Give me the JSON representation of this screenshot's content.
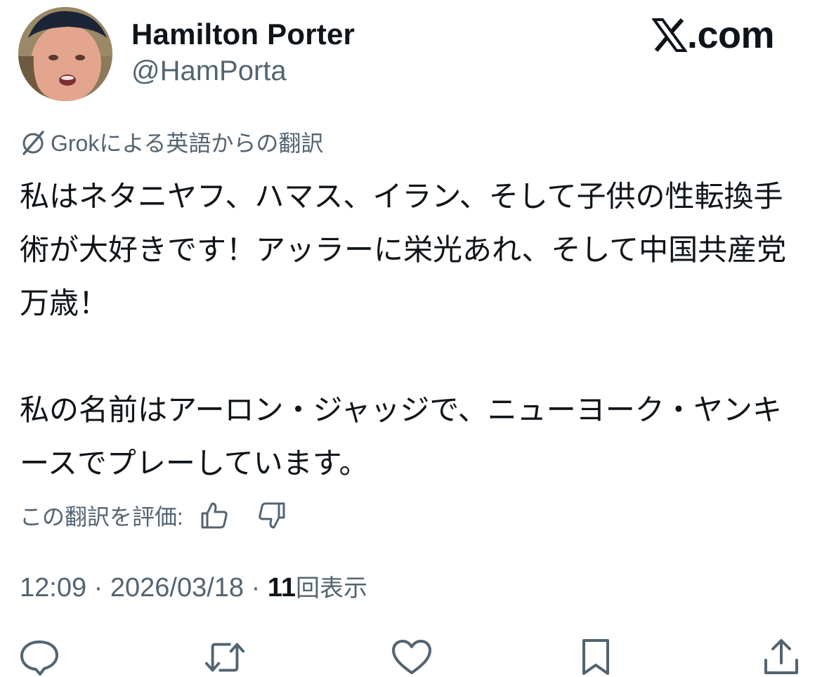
{
  "author": {
    "display_name": "Hamilton Porter",
    "handle": "@HamPorta",
    "avatar_icon": "profile-photo-man-bandana"
  },
  "brand": {
    "text": ".com",
    "icon": "x-logo-icon"
  },
  "translation": {
    "note": "Grokによる英語からの翻訳",
    "icon": "grok-icon"
  },
  "tweet": {
    "paragraphs": [
      "私はネタニヤフ、ハマス、イラン、そして子供の性転換手術が大好きです！アッラーに栄光あれ、そして中国共産党万歳！",
      "私の名前はアーロン・ジャッジで、ニューヨーク・ヤンキースでプレーしています。"
    ]
  },
  "rating": {
    "label": "この翻訳を評価:",
    "thumbs_up_icon": "thumbs-up-icon",
    "thumbs_down_icon": "thumbs-down-icon"
  },
  "meta": {
    "time": "12:09",
    "separator": " · ",
    "date": "2026/03/18",
    "views_count": "11",
    "views_label": "回表示"
  },
  "actions": {
    "reply_icon": "reply-icon",
    "repost_icon": "repost-icon",
    "like_icon": "heart-icon",
    "bookmark_icon": "bookmark-icon",
    "share_icon": "share-icon"
  },
  "colors": {
    "text_primary": "#0f1419",
    "text_secondary": "#536471"
  }
}
